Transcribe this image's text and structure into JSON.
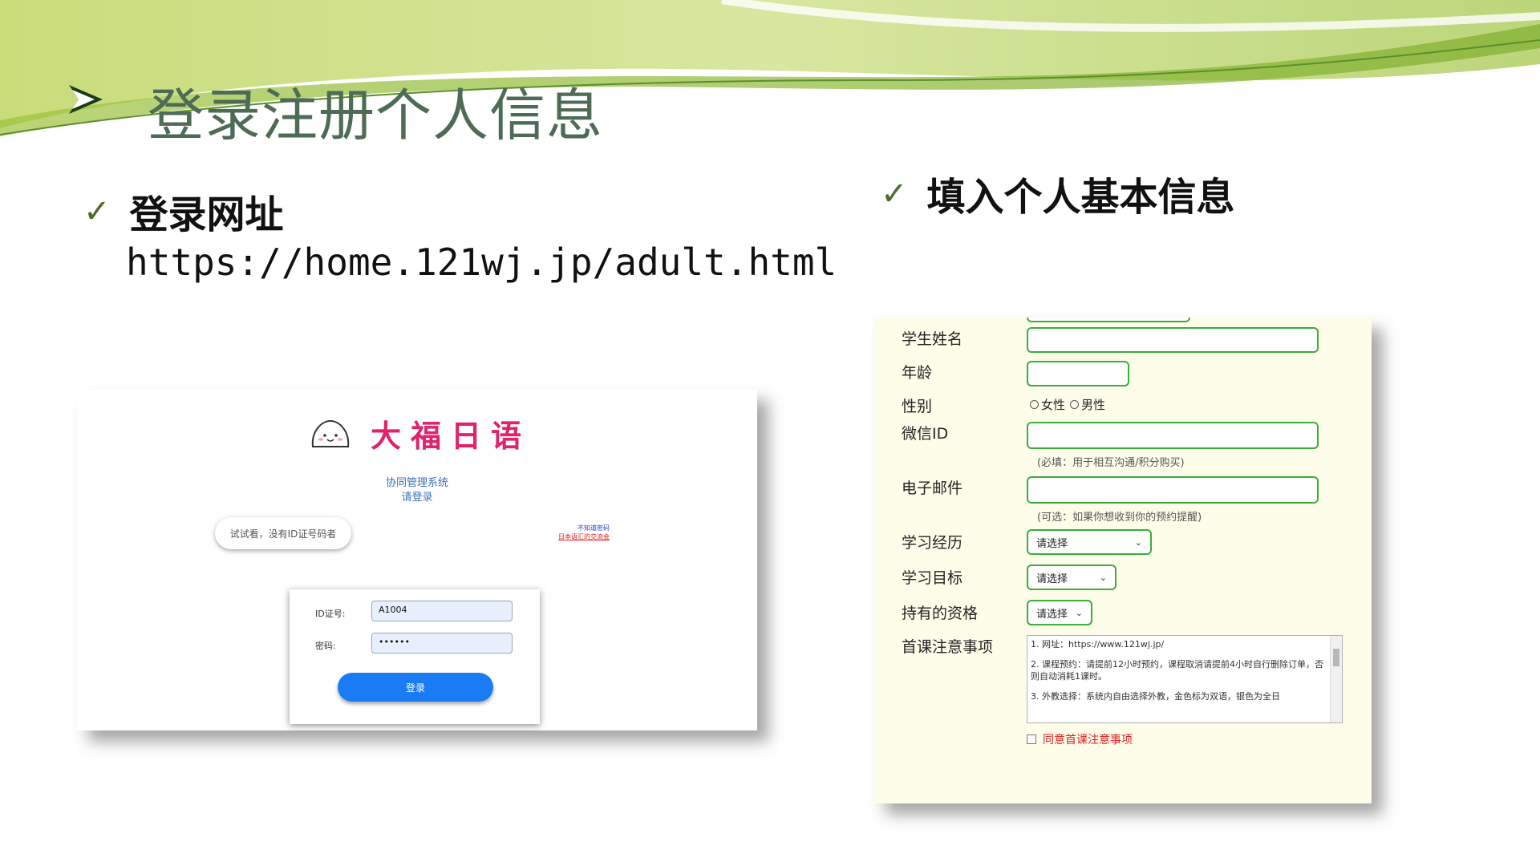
{
  "slide": {
    "title": "登录注册个人信息",
    "bullet_left": "登录网址",
    "url": "https://home.121wj.jp/adult.html",
    "bullet_right": "填入个人基本信息"
  },
  "login_page": {
    "brand": "大福日语",
    "system_name": "协同管理系统",
    "login_prompt": "请登录",
    "try_button": "试试看，没有ID证号码者",
    "forgot_password": "不知道密码",
    "reset_link": "日本语汇的交流会",
    "id_label": "ID证号:",
    "id_value": "A1004",
    "password_label": "密码:",
    "password_value": "••••••",
    "login_button": "登录"
  },
  "form": {
    "name_label": "学生姓名",
    "age_label": "年龄",
    "gender_label": "性别",
    "gender_female": "女性",
    "gender_male": "男性",
    "wechat_label": "微信ID",
    "wechat_note": "(必填：用于相互沟通/积分购买)",
    "email_label": "电子邮件",
    "email_note": "(可选：如果你想收到你的预约提醒)",
    "history_label": "学习经历",
    "history_value": "请选择",
    "goal_label": "学习目标",
    "goal_value": "请选择",
    "cert_label": "持有的资格",
    "cert_value": "请选择",
    "notes_label": "首课注意事项",
    "notes_line1": "1. 网址：https://www.121wj.jp/",
    "notes_line2": "2. 课程预约：请提前12小时预约，课程取消请提前4小时自行删除订单，否则自动消耗1课时。",
    "notes_line3": "3. 外教选择：系统内自由选择外教，金色标为双语，银色为全日",
    "agree_label": "同意首课注意事项"
  },
  "colors": {
    "title_color": "#4d6b55",
    "check_color": "#4f6b2a",
    "brand_color": "#e0236a",
    "field_border": "#3aae3a",
    "login_button_bg": "#1a7cf5",
    "form_bg": "#fdfdea"
  }
}
